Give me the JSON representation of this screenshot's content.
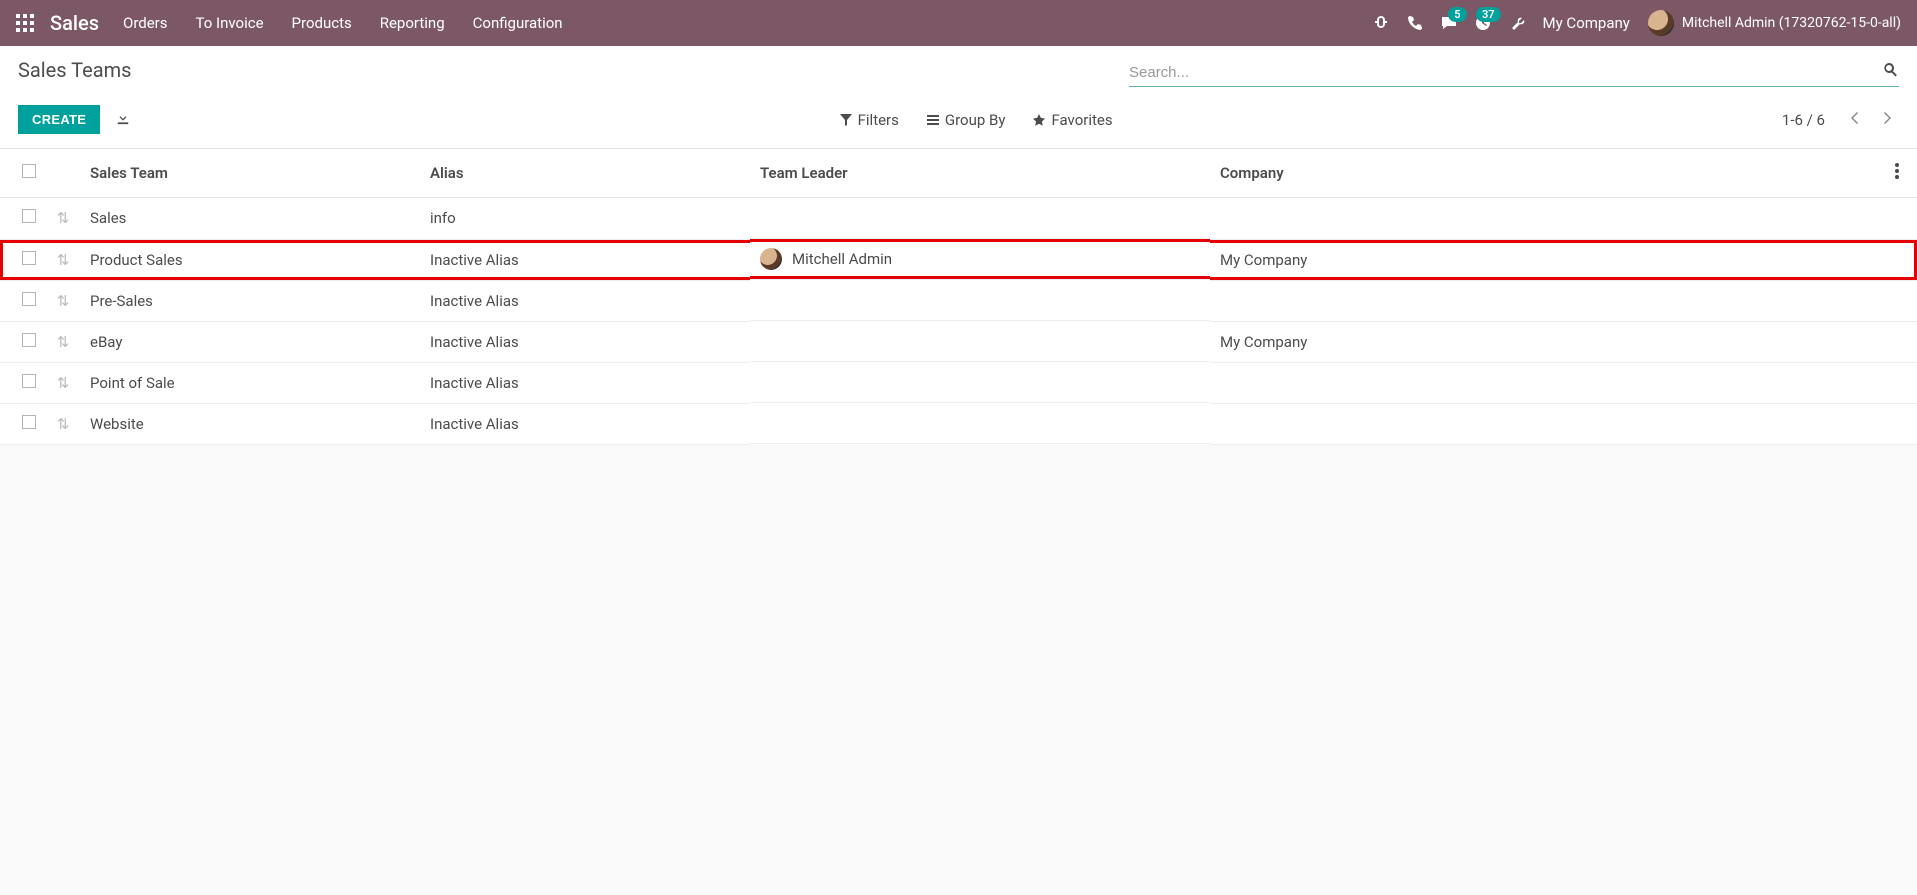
{
  "nav": {
    "brand": "Sales",
    "menu": [
      "Orders",
      "To Invoice",
      "Products",
      "Reporting",
      "Configuration"
    ],
    "messaging_badge": "5",
    "activities_badge": "37",
    "company": "My Company",
    "user": "Mitchell Admin (17320762-15-0-all)"
  },
  "control": {
    "title": "Sales Teams",
    "create": "CREATE",
    "search_placeholder": "Search...",
    "filters": "Filters",
    "groupby": "Group By",
    "favorites": "Favorites",
    "pager": "1-6 / 6"
  },
  "table": {
    "headers": {
      "name": "Sales Team",
      "alias": "Alias",
      "leader": "Team Leader",
      "company": "Company"
    },
    "rows": [
      {
        "name": "Sales",
        "alias": "info",
        "leader": "",
        "company": "",
        "highlight": false,
        "avatar": false
      },
      {
        "name": "Product Sales",
        "alias": "Inactive Alias",
        "leader": "Mitchell Admin",
        "company": "My Company",
        "highlight": true,
        "avatar": true
      },
      {
        "name": "Pre-Sales",
        "alias": "Inactive Alias",
        "leader": "",
        "company": "",
        "highlight": false,
        "avatar": false
      },
      {
        "name": "eBay",
        "alias": "Inactive Alias",
        "leader": "",
        "company": "My Company",
        "highlight": false,
        "avatar": false
      },
      {
        "name": "Point of Sale",
        "alias": "Inactive Alias",
        "leader": "",
        "company": "",
        "highlight": false,
        "avatar": false
      },
      {
        "name": "Website",
        "alias": "Inactive Alias",
        "leader": "",
        "company": "",
        "highlight": false,
        "avatar": false
      }
    ]
  }
}
